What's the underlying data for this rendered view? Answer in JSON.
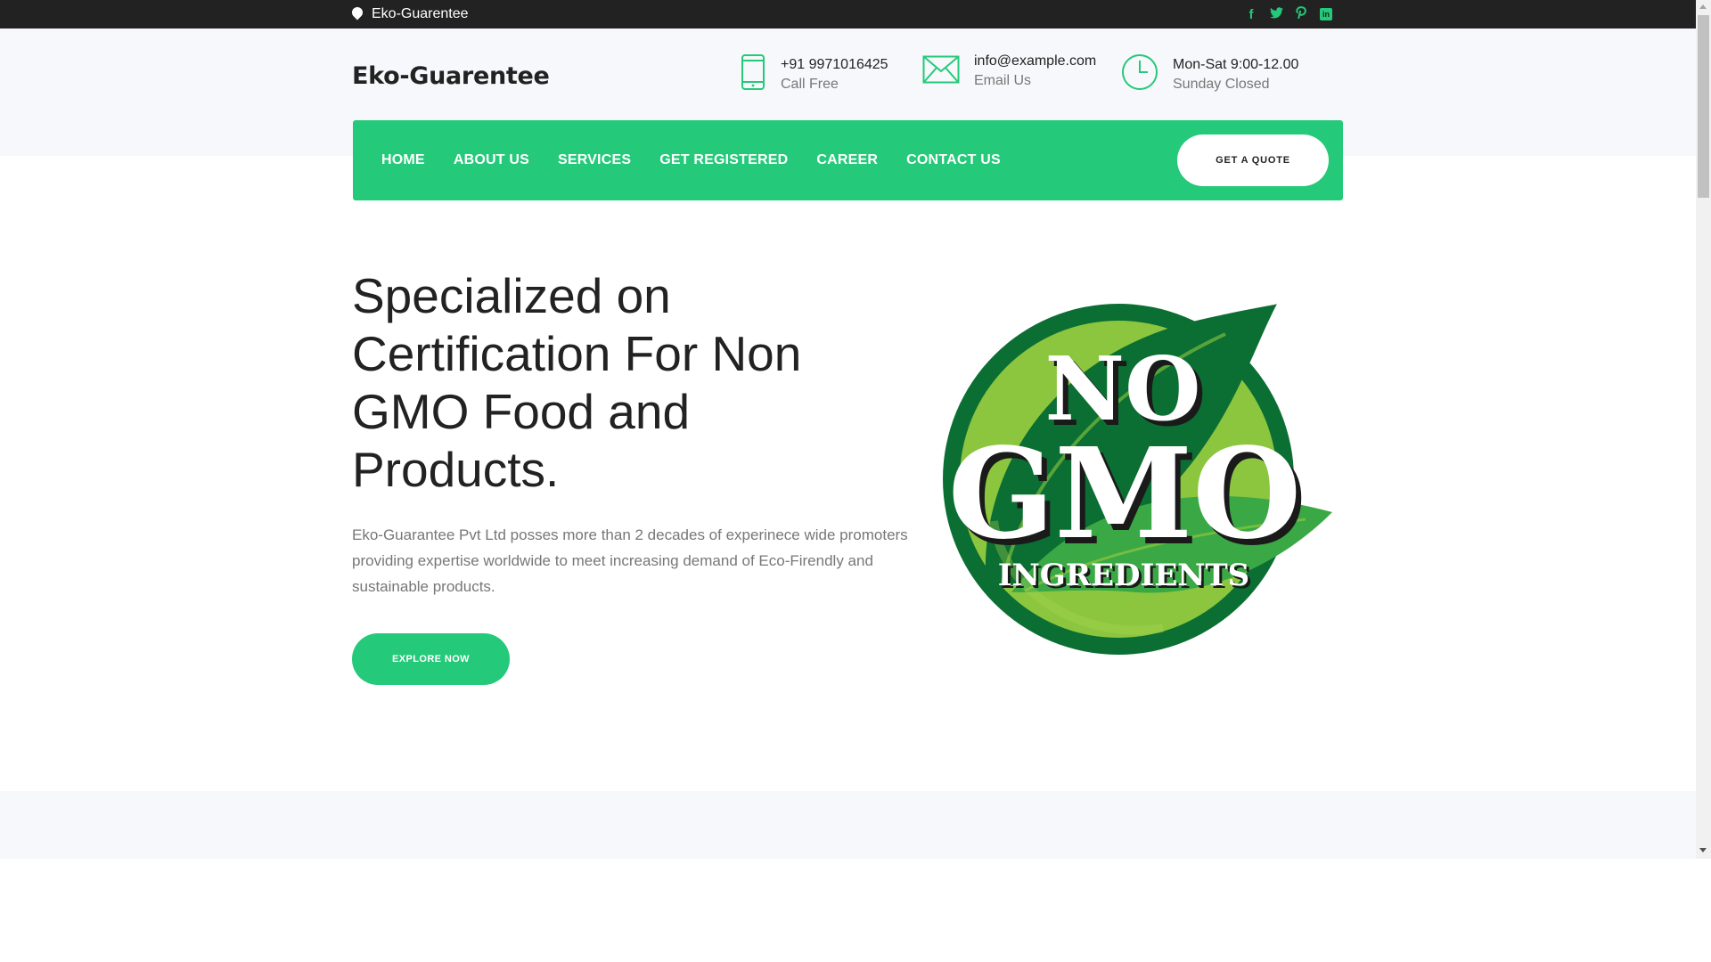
{
  "topbar": {
    "location_text": "Eko-Guarentee",
    "socials": [
      {
        "name": "facebook-icon",
        "glyph": "f"
      },
      {
        "name": "twitter-icon",
        "glyph": "t"
      },
      {
        "name": "pinterest-icon",
        "glyph": "p"
      },
      {
        "name": "linkedin-icon",
        "glyph": "in"
      }
    ]
  },
  "header": {
    "brand": "Eko-Guarentee",
    "phone": {
      "number": "+91 9971016425",
      "label": "Call Free"
    },
    "email": {
      "address": "info@example.com",
      "label": "Email Us"
    },
    "hours": {
      "time": "Mon-Sat 9:00-12.00",
      "label": "Sunday Closed"
    }
  },
  "nav": {
    "items": [
      "HOME",
      "ABOUT US",
      "SERVICES",
      "GET REGISTERED",
      "CAREER",
      "CONTACT US"
    ],
    "quote_label": "GET A QUOTE"
  },
  "hero": {
    "title": "Specialized on Certification For Non GMO Food and Products.",
    "text": "Eko-Guarantee Pvt Ltd posses more than 2 decades of experinece wide promoters providing expertise worldwide to meet increasing demand of Eco-Firendly and sustainable products.",
    "cta_label": "EXPLORE NOW",
    "badge": {
      "line1": "NO",
      "line2": "GMO",
      "line3": "INGREDIENTS"
    }
  },
  "colors": {
    "accent": "#24c979",
    "topbar_bg": "#222222",
    "header_bg": "#f7f8fb",
    "badge_dark": "#0b6e32",
    "badge_light": "#8cc63f"
  }
}
